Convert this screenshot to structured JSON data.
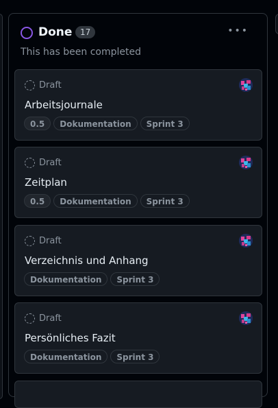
{
  "column": {
    "title": "Done",
    "count": "17",
    "description": "This has been completed",
    "more_glyph": "•••"
  },
  "cards": [
    {
      "status": "Draft",
      "title": "Arbeitsjournale",
      "labels": [
        "0.5",
        "Dokumentation",
        "Sprint 3"
      ]
    },
    {
      "status": "Draft",
      "title": "Zeitplan",
      "labels": [
        "0.5",
        "Dokumentation",
        "Sprint 3"
      ]
    },
    {
      "status": "Draft",
      "title": "Verzeichnis und Anhang",
      "labels": [
        "Dokumentation",
        "Sprint 3"
      ]
    },
    {
      "status": "Draft",
      "title": "Persönliches Fazit",
      "labels": [
        "Dokumentation",
        "Sprint 3"
      ]
    }
  ],
  "colors": {
    "background": "#010409",
    "card": "#161b22",
    "border": "#30363d",
    "done_purple": "#8957e5",
    "muted_text": "#8b949e"
  },
  "icons": {
    "status": "done-circle-icon",
    "draft": "draft-dashed-circle-icon",
    "avatar": "user-avatar-icon",
    "more": "more-horizontal-icon"
  }
}
